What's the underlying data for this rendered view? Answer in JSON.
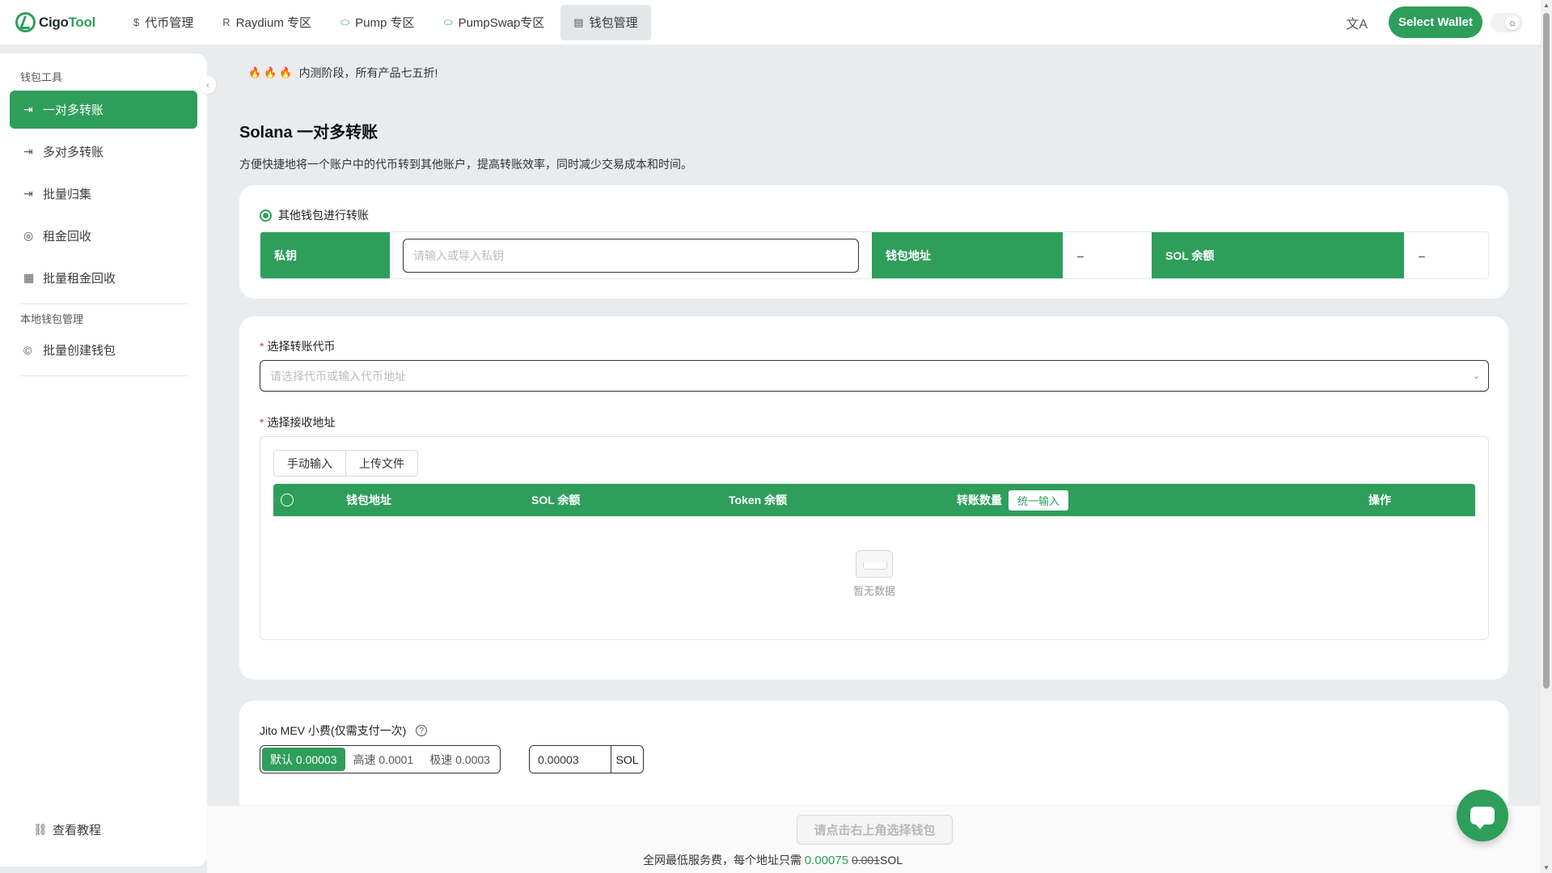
{
  "brand": {
    "logo_text_a": "Cigo",
    "logo_text_b": "Tool"
  },
  "nav": {
    "items": [
      {
        "icon": "$",
        "label": "代币管理"
      },
      {
        "icon": "R",
        "label": "Raydium 专区"
      },
      {
        "icon": "⬭",
        "label": "Pump 专区"
      },
      {
        "icon": "⬭",
        "label": "PumpSwap专区"
      },
      {
        "icon": "▤",
        "label": "钱包管理"
      }
    ],
    "active_index": 4,
    "translate_icon": "文A",
    "select_wallet_label": "Select Wallet",
    "theme_icon": "☼"
  },
  "sidebar": {
    "group1_title": "钱包工具",
    "items": [
      {
        "icon": "⇥",
        "label": "一对多转账"
      },
      {
        "icon": "⇥",
        "label": "多对多转账"
      },
      {
        "icon": "⇥",
        "label": "批量归集"
      },
      {
        "icon": "◎",
        "label": "租金回收"
      },
      {
        "icon": "▦",
        "label": "批量租金回收"
      }
    ],
    "group2_title": "本地钱包管理",
    "items2": [
      {
        "icon": "©",
        "label": "批量创建钱包"
      }
    ],
    "footer_label": "查看教程",
    "footer_icon": "🔗"
  },
  "notice": {
    "fire": "🔥",
    "text": "内测阶段，所有产品七五折!"
  },
  "page": {
    "title": "Solana 一对多转账",
    "description": "方便快捷地将一个账户中的代币转到其他账户，提高转账效率，同时减少交易成本和时间。"
  },
  "wallet_card": {
    "radio_label": "其他钱包进行转账",
    "private_key_label": "私钥",
    "private_key_placeholder": "请输入或导入私钥",
    "wallet_address_label": "钱包地址",
    "wallet_address_value": "–",
    "sol_balance_label": "SOL 余额",
    "sol_balance_value": "–"
  },
  "transfer_card": {
    "token_label": "选择转账代币",
    "token_placeholder": "请选择代币或输入代币地址",
    "recv_label": "选择接收地址",
    "tabs": [
      "手动输入",
      "上传文件"
    ],
    "columns": {
      "wallet_address": "钱包地址",
      "sol_balance": "SOL 余额",
      "token_balance": "Token 余额",
      "amount": "转账数量",
      "unify": "统一输入",
      "action": "操作"
    },
    "empty_text": "暂无数据"
  },
  "fee_card": {
    "label": "Jito MEV 小费(仅需支付一次)",
    "help_icon": "?",
    "options": [
      "默认 0.00003",
      "高速 0.0001",
      "极速 0.0003"
    ],
    "active_option": 0,
    "custom_value": "0.00003",
    "unit": "SOL"
  },
  "bottom": {
    "submit_label": "请点击右上角选择钱包",
    "fee_prefix": "全网最低服务费，每个地址只需",
    "fee_price": "0.00075",
    "fee_old": "0.001",
    "fee_unit": "SOL"
  },
  "colors": {
    "accent": "#2e9e5b",
    "background": "#e9ebed"
  }
}
